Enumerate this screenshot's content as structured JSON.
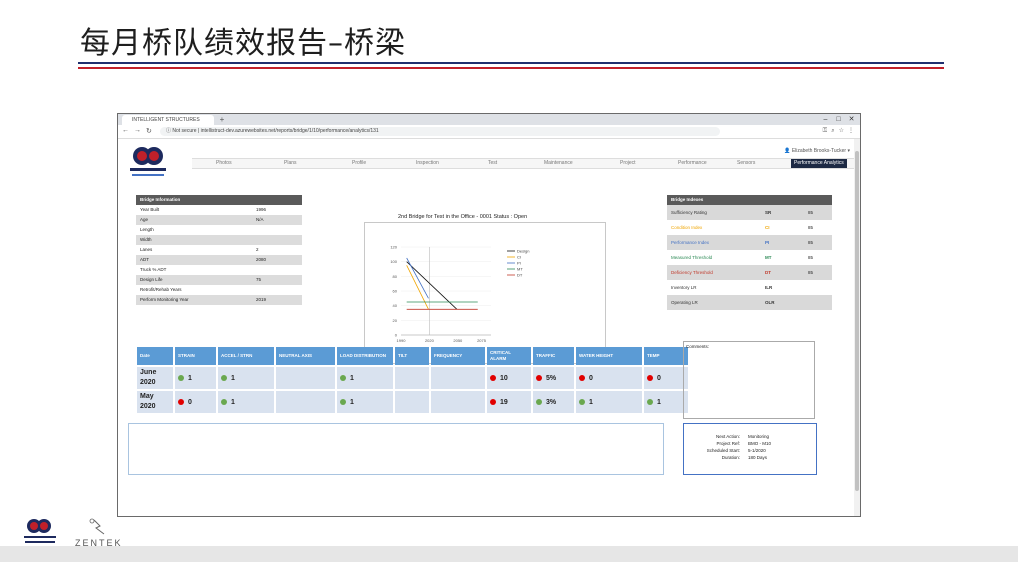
{
  "slide": {
    "title": "每月桥队绩效报告–桥梁",
    "footer_brand": "ZENTEK",
    "logo_text": "INTELLIGENT STRUCTURES"
  },
  "browser": {
    "tab_title": "INTELLIGENT STRUCTURES",
    "not_secure": "Not secure",
    "url": "intellistruct-dev.azurewebsites.net/reports/bridge/1/10/performance/analytics/131"
  },
  "app": {
    "user": "Elizabeth Brooks-Tucker",
    "nav": [
      "Photos",
      "Plans",
      "Profile",
      "Inspection",
      "Test",
      "Maintenance",
      "Project",
      "Performance",
      "Sensors",
      "Performance Analytics"
    ],
    "bridge_info": {
      "heading": "Bridge Information",
      "rows": [
        {
          "label": "Year Built",
          "value": "1996"
        },
        {
          "label": "Age",
          "value": "N/A"
        },
        {
          "label": "Length",
          "value": ""
        },
        {
          "label": "Width",
          "value": ""
        },
        {
          "label": "Lanes",
          "value": "2"
        },
        {
          "label": "ADT",
          "value": "2080"
        },
        {
          "label": "Truck % ADT",
          "value": ""
        },
        {
          "label": "Design Life",
          "value": "75"
        },
        {
          "label": "Retrofit/Rehab Years",
          "value": ""
        },
        {
          "label": "Perform Monitoring Year",
          "value": "2019"
        }
      ]
    },
    "chart_title": "2nd Bridge for Test in the Office - 0001     Status : Open",
    "indexes": {
      "heading": "Bridge Indexes",
      "rows": [
        {
          "label": "Sufficiency Rating",
          "code": "SR",
          "value": "85",
          "color": "#333333"
        },
        {
          "label": "Condition Index",
          "code": "CI",
          "value": "85",
          "color": "#f0a500"
        },
        {
          "label": "Performance Index",
          "code": "PI",
          "value": "85",
          "color": "#4472c4"
        },
        {
          "label": "Measured Threshold",
          "code": "MT",
          "value": "85",
          "color": "#2e8b57"
        },
        {
          "label": "Deficiency Threshold",
          "code": "DT",
          "value": "85",
          "color": "#c0392b"
        },
        {
          "label": "Inventory LR",
          "code": "ILR",
          "value": "",
          "color": "#333333"
        },
        {
          "label": "Operating LR",
          "code": "OLR",
          "value": "",
          "color": "#333333"
        }
      ]
    },
    "status_table": {
      "headers": [
        "Date",
        "STRAIN",
        "ACCEL / STRN",
        "NEUTRAL AXIS",
        "LOAD DISTRIBUTION",
        "TILT",
        "FREQUENCY",
        "CRITICAL ALARM",
        "TRAFFIC",
        "WATER HEIGHT",
        "TEMP"
      ],
      "rows": [
        {
          "date": "June 2020",
          "cells": [
            {
              "status": "green",
              "text": "1"
            },
            {
              "status": "green",
              "text": "1"
            },
            {
              "status": "",
              "text": ""
            },
            {
              "status": "green",
              "text": "1"
            },
            {
              "status": "",
              "text": ""
            },
            {
              "status": "",
              "text": ""
            },
            {
              "status": "red",
              "text": "10"
            },
            {
              "status": "red",
              "text": "5%"
            },
            {
              "status": "red",
              "text": "0"
            },
            {
              "status": "red",
              "text": "0"
            }
          ]
        },
        {
          "date": "May 2020",
          "cells": [
            {
              "status": "red",
              "text": "0"
            },
            {
              "status": "green",
              "text": "1"
            },
            {
              "status": "",
              "text": ""
            },
            {
              "status": "green",
              "text": "1"
            },
            {
              "status": "",
              "text": ""
            },
            {
              "status": "",
              "text": ""
            },
            {
              "status": "red",
              "text": "19"
            },
            {
              "status": "green",
              "text": "3%"
            },
            {
              "status": "green",
              "text": "1"
            },
            {
              "status": "green",
              "text": "1"
            }
          ]
        }
      ]
    },
    "comments_label": "Comments:",
    "next_action": [
      {
        "label": "Next Action:",
        "value": "Monitoring"
      },
      {
        "label": "Project Ref:",
        "value": "BMO - M10"
      },
      {
        "label": "Scheduled Start:",
        "value": "5-1/2020"
      },
      {
        "label": "Duration:",
        "value": "180 Days"
      }
    ]
  },
  "chart_data": {
    "type": "line",
    "title": "",
    "xlabel": "",
    "ylabel": "",
    "xlim": [
      1990,
      2085
    ],
    "ylim": [
      0,
      120
    ],
    "xticks": [
      1990,
      2020,
      2050,
      2075
    ],
    "yticks": [
      0,
      20,
      40,
      60,
      80,
      100,
      120
    ],
    "legend": "right",
    "series": [
      {
        "name": "Design",
        "color": "#111111",
        "x": [
          1996,
          2049
        ],
        "y": [
          100,
          35
        ]
      },
      {
        "name": "CI",
        "color": "#f0a500",
        "x": [
          1996,
          2019
        ],
        "y": [
          95,
          35
        ]
      },
      {
        "name": "PI",
        "color": "#4472c4",
        "x": [
          1996,
          2019
        ],
        "y": [
          105,
          50
        ]
      },
      {
        "name": "MT",
        "color": "#2e8b57",
        "x": [
          1996,
          2071
        ],
        "y": [
          45,
          45
        ]
      },
      {
        "name": "DT",
        "color": "#c0392b",
        "x": [
          1996,
          2071
        ],
        "y": [
          35,
          35
        ]
      }
    ],
    "vline_x": 2020
  }
}
